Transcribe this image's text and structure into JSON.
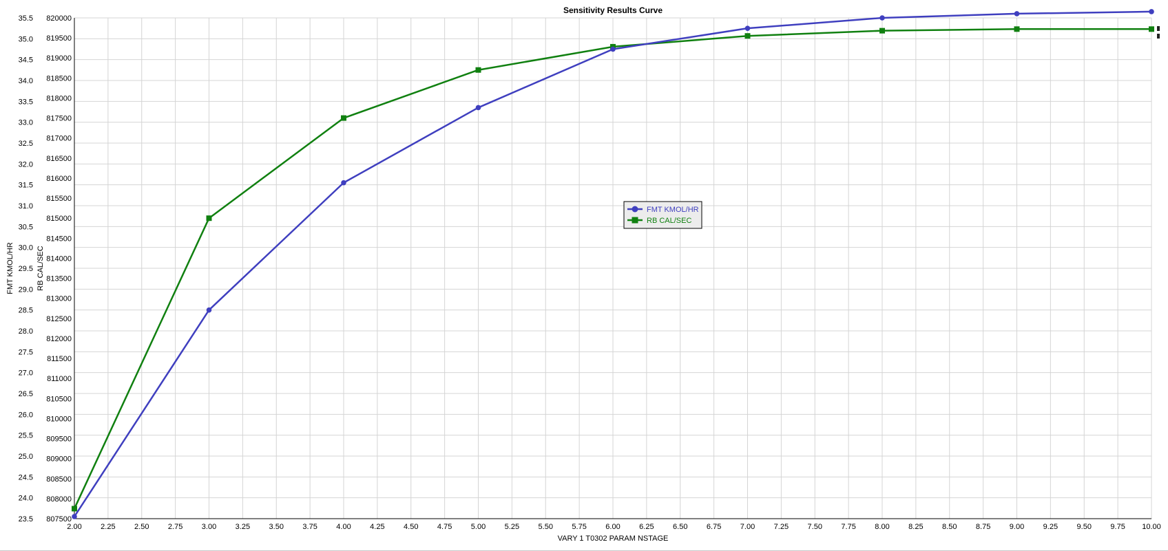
{
  "chart_data": {
    "type": "line",
    "title": "Sensitivity Results Curve",
    "xlabel": "VARY   1 T0302 PARAM NSTAGE",
    "ylabel_left_outer": "FMT KMOL/HR",
    "ylabel_left_inner": "RB CAL/SEC",
    "xlim": [
      2.0,
      10.0
    ],
    "x_ticks": [
      "2.00",
      "2.25",
      "2.50",
      "2.75",
      "3.00",
      "3.25",
      "3.50",
      "3.75",
      "4.00",
      "4.25",
      "4.50",
      "4.75",
      "5.00",
      "5.25",
      "5.50",
      "5.75",
      "6.00",
      "6.25",
      "6.50",
      "6.75",
      "7.00",
      "7.25",
      "7.50",
      "7.75",
      "8.00",
      "8.25",
      "8.50",
      "8.75",
      "9.00",
      "9.25",
      "9.50",
      "9.75",
      "10.00"
    ],
    "y1lim": [
      23.5,
      35.5
    ],
    "y1_ticks": [
      "35.5",
      "35.0",
      "34.5",
      "34.0",
      "33.5",
      "33.0",
      "32.5",
      "32.0",
      "31.5",
      "31.0",
      "30.5",
      "30.0",
      "29.5",
      "29.0",
      "28.5",
      "28.0",
      "27.5",
      "27.0",
      "26.5",
      "26.0",
      "25.5",
      "25.0",
      "24.5",
      "24.0",
      "23.5"
    ],
    "y2lim": [
      807500,
      820000
    ],
    "y2_ticks": [
      "820000",
      "819500",
      "819000",
      "818500",
      "818000",
      "817500",
      "817000",
      "816500",
      "816000",
      "815500",
      "815000",
      "814500",
      "814000",
      "813500",
      "813000",
      "812500",
      "812000",
      "811500",
      "811000",
      "810500",
      "810000",
      "809500",
      "809000",
      "808500",
      "808000",
      "807500"
    ],
    "grid": true,
    "legend_position": "center",
    "x": [
      2,
      3,
      4,
      5,
      6,
      7,
      8,
      9,
      10
    ],
    "series": [
      {
        "name": "FMT KMOL/HR",
        "axis": "left",
        "color": "#3f3fbf",
        "marker": "circle",
        "values": [
          23.55,
          28.5,
          31.55,
          33.35,
          34.75,
          35.25,
          35.5,
          35.6,
          35.65
        ]
      },
      {
        "name": "RB CAL/SEC",
        "axis": "right",
        "color": "#108010",
        "marker": "square",
        "values": [
          807750,
          815000,
          817500,
          818700,
          819280,
          819550,
          819680,
          819720,
          819720
        ]
      }
    ]
  }
}
